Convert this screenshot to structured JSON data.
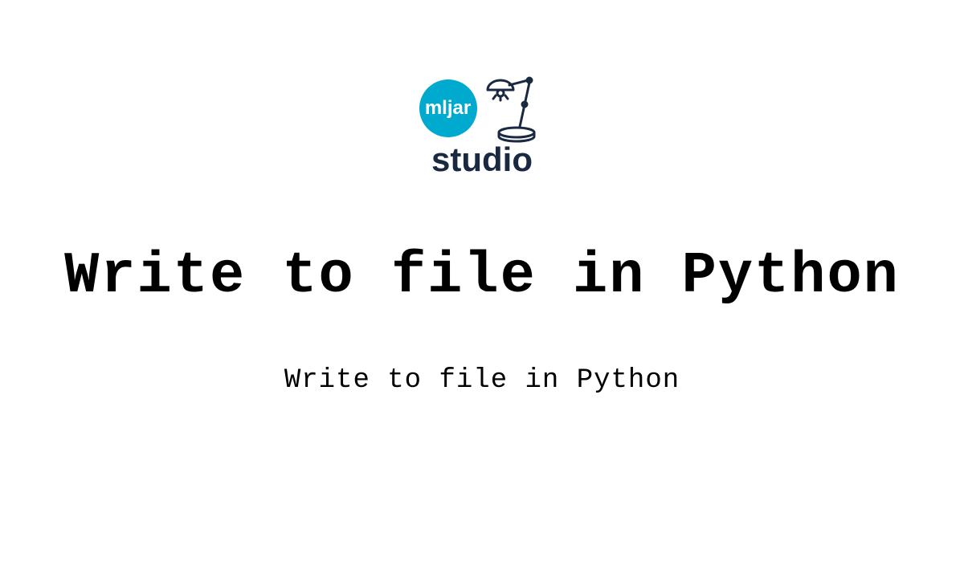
{
  "logo": {
    "circle_text": "mljar",
    "studio_text": "studio"
  },
  "heading": "Write to file in Python",
  "subheading": "Write to file in Python",
  "colors": {
    "circle_bg": "#00a9ce",
    "studio_color": "#1a2941"
  }
}
